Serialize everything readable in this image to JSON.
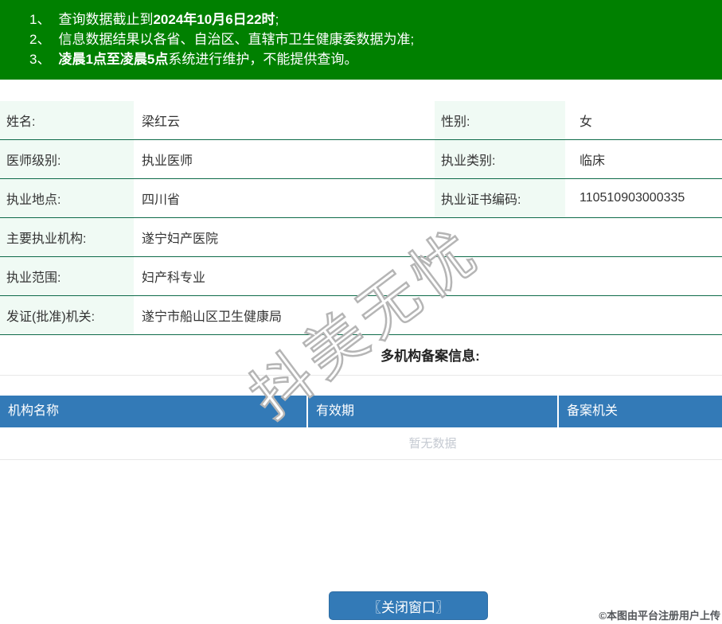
{
  "banner": {
    "notices": [
      {
        "num": "1、",
        "pre": "查询数据截止到",
        "bold": "2024年10月6日22时",
        "post": ";"
      },
      {
        "num": "2、",
        "pre": "信息数据结果以各省、自治区、直辖市卫生健康委数据为准;",
        "bold": "",
        "post": ""
      },
      {
        "num": "3、",
        "pre": "",
        "bold": "凌晨1点至凌晨5点",
        "post": "系统进行维护，不能提供查询。"
      }
    ]
  },
  "doctor": {
    "name_label": "姓名:",
    "name": "梁红云",
    "gender_label": "性别:",
    "gender": "女",
    "level_label": "医师级别:",
    "level": "执业医师",
    "category_label": "执业类别:",
    "category": "临床",
    "location_label": "执业地点:",
    "location": "四川省",
    "cert_label": "执业证书编码:",
    "cert": "110510903000335",
    "org_label": "主要执业机构:",
    "org": "遂宁妇产医院",
    "scope_label": "执业范围:",
    "scope": "妇产科专业",
    "authority_label": "发证(批准)机关:",
    "authority": "遂宁市船山区卫生健康局"
  },
  "multi_org": {
    "title": "多机构备案信息:",
    "columns": [
      "机构名称",
      "有效期",
      "备案机关"
    ],
    "empty_text": "暂无数据"
  },
  "watermark_text": "抖美无忧",
  "close_button_label": "〖关闭窗口〗",
  "footer_credit": "©本图由平台注册用户上传",
  "colors": {
    "banner_green": "#008000",
    "row_line_green": "#0e6b4a",
    "label_bg_mint": "#f0faf4",
    "header_blue": "#337ab7",
    "empty_text_gray": "#c5cad2"
  }
}
